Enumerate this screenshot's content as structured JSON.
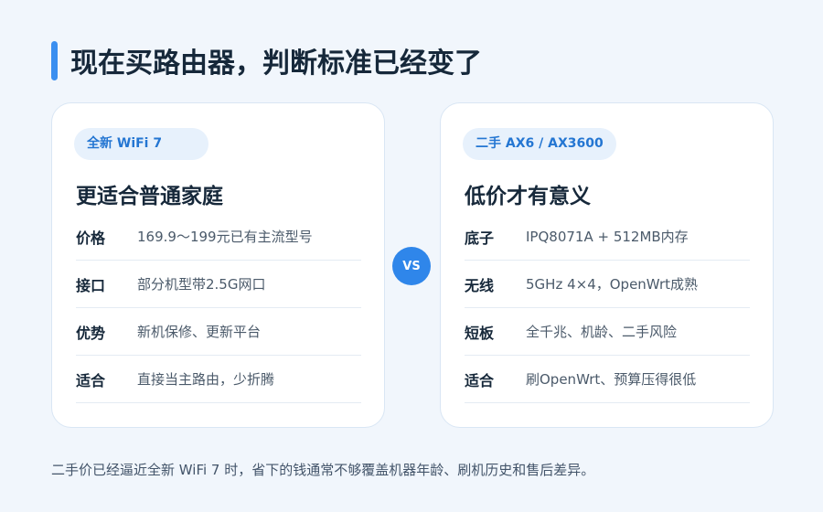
{
  "header": {
    "title": "现在买路由器，判断标准已经变了"
  },
  "cards": [
    {
      "tag": "全新 WiFi 7",
      "heading": "更适合普通家庭",
      "rows": [
        {
          "key": "价格",
          "value": "169.9～199元已有主流型号"
        },
        {
          "key": "接口",
          "value": "部分机型带2.5G网口"
        },
        {
          "key": "优势",
          "value": "新机保修、更新平台"
        },
        {
          "key": "适合",
          "value": "直接当主路由，少折腾"
        }
      ]
    },
    {
      "tag": "二手 AX6 / AX3600",
      "heading": "低价才有意义",
      "rows": [
        {
          "key": "底子",
          "value": "IPQ8071A + 512MB内存"
        },
        {
          "key": "无线",
          "value": "5GHz 4×4，OpenWrt成熟"
        },
        {
          "key": "短板",
          "value": "全千兆、机龄、二手风险"
        },
        {
          "key": "适合",
          "value": "刷OpenWrt、预算压得很低"
        }
      ]
    }
  ],
  "vs_label": "VS",
  "footnote": "二手价已经逼近全新 WiFi 7 时，省下的钱通常不够覆盖机器年龄、刷机历史和售后差异。",
  "colors": {
    "background": "#f1f6fc",
    "accent": "#2f86ea",
    "tag_bg": "#e7f1fc",
    "tag_text": "#2476d2"
  }
}
